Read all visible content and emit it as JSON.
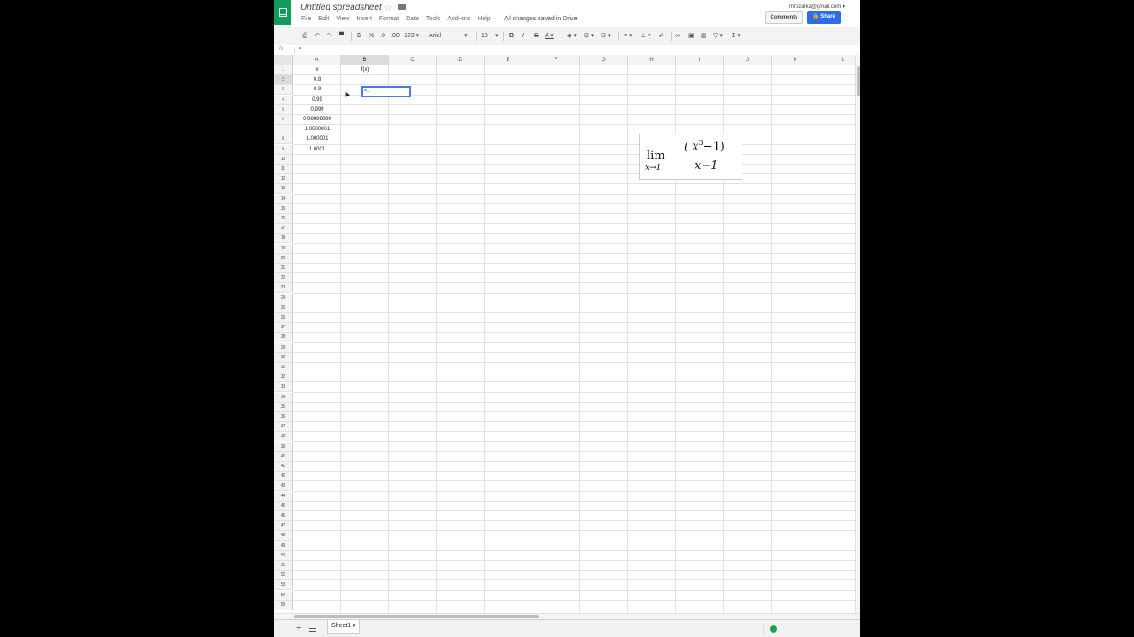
{
  "header": {
    "doc_title": "Untitled spreadsheet",
    "star_icon": "star-icon",
    "folder_icon": "folder-icon",
    "menu": [
      "File",
      "Edit",
      "View",
      "Insert",
      "Format",
      "Data",
      "Tools",
      "Add-ons",
      "Help"
    ],
    "save_status": "All changes saved in Drive",
    "account": "mrozarka@gmail.com",
    "comments_label": "Comments",
    "share_label": "Share"
  },
  "toolbar": {
    "currency": "$",
    "percent": "%",
    "decimal_less": ".0",
    "decimal_more": ".00",
    "format_more": "123",
    "font": "Arial",
    "font_size": "10",
    "bold": "B",
    "italic": "I",
    "strike": "S",
    "text_color": "A",
    "sum": "Σ"
  },
  "formula_bar": {
    "fx_label": "fx",
    "value": "="
  },
  "columns": [
    "A",
    "B",
    "C",
    "D",
    "E",
    "F",
    "G",
    "H",
    "I",
    "J",
    "K",
    "L"
  ],
  "selected_column": "B",
  "rows_visible": 55,
  "selected_row": 2,
  "cells": {
    "A1": "x",
    "B1": "f(x)",
    "A2": "0.8",
    "A3": "0.9",
    "A4": "0.99",
    "A5": "0.999",
    "A6": "0.99999999",
    "A7": "1.0000001",
    "A8": "1.000001",
    "A9": "1.0001"
  },
  "active_cell": {
    "ref": "B2",
    "content": "=..."
  },
  "formula_image": {
    "lim": "lim",
    "subscript": "x→1",
    "numerator_open": "( x",
    "numerator_exp": "3",
    "numerator_close": "−1)",
    "denominator": "x−1"
  },
  "sheet_tabs": {
    "add_icon": "plus-icon",
    "list_icon": "list-icon",
    "tabs": [
      "Sheet1"
    ],
    "status_icon": "check-circle-icon"
  },
  "colors": {
    "brand": "#0f9d58",
    "share": "#2d6ce6",
    "selection": "#4a7bdc",
    "status_ok": "#1e9e4a"
  }
}
